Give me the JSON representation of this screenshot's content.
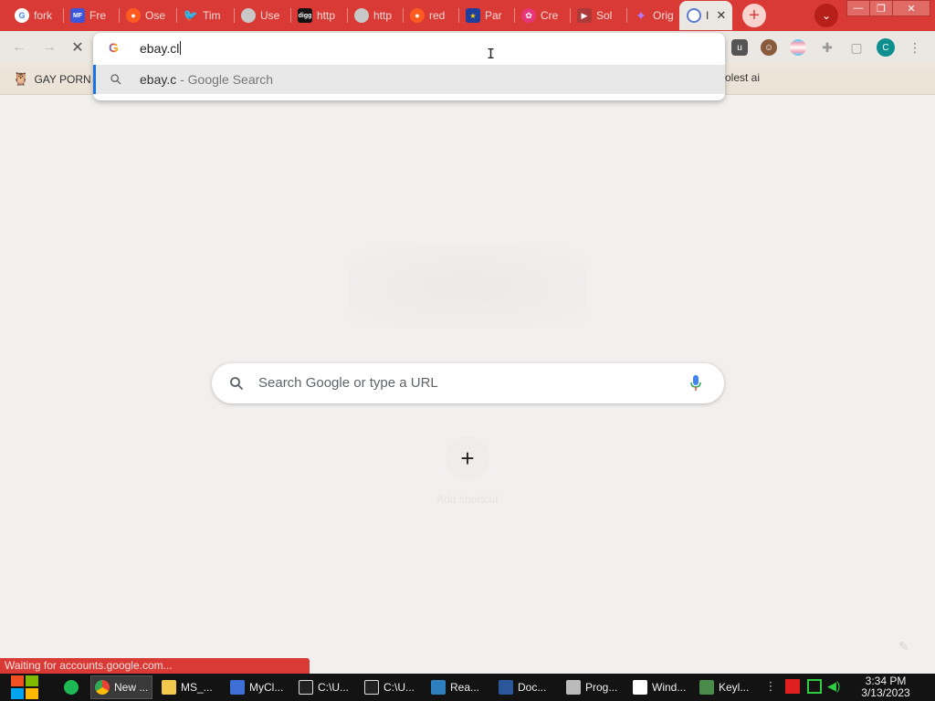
{
  "tabs": [
    {
      "label": "fork",
      "favicon": "google-icon",
      "color": "#ffffff"
    },
    {
      "label": "Fre",
      "favicon": "mft-icon",
      "color": "#3b56d8"
    },
    {
      "label": "Ose",
      "favicon": "reddit-icon",
      "color": "#ff5a1f"
    },
    {
      "label": "Tim",
      "favicon": "twitter-icon",
      "color": "#1da1f2"
    },
    {
      "label": "Use",
      "favicon": "globe-icon",
      "color": "#bbbbbb"
    },
    {
      "label": "http",
      "favicon": "digg-icon",
      "color": "#111111"
    },
    {
      "label": "http",
      "favicon": "globe-icon",
      "color": "#bbbbbb"
    },
    {
      "label": "red",
      "favicon": "reddit-icon",
      "color": "#ff5a1f"
    },
    {
      "label": "Par",
      "favicon": "eu-flag-icon",
      "color": "#1f3f9a"
    },
    {
      "label": "Cre",
      "favicon": "creative-icon",
      "color": "#e8367a"
    },
    {
      "label": "Sol",
      "favicon": "video-icon",
      "color": "#ad3a3a"
    },
    {
      "label": "Orig",
      "favicon": "star-icon",
      "color": "#8a4fd8"
    }
  ],
  "active_tab": {
    "label": "I",
    "favicon": "loading-icon",
    "close": "✕"
  },
  "window_controls": {
    "minimize": "—",
    "restore": "❐",
    "close": "✕"
  },
  "omnibox": {
    "typed_text": "ebay.cl",
    "suggestion_main": "ebay.c",
    "suggestion_sub": " - Google Search"
  },
  "bookmarks": [
    {
      "label": "GAY PORN",
      "icon": "owl-icon"
    },
    {
      "label": "olest ai",
      "icon": ""
    }
  ],
  "profile_initial": "C",
  "ntp": {
    "search_placeholder": "Search Google or type a URL",
    "shortcut_symbol": "+",
    "shortcut_label": "Add shortcut"
  },
  "status_text": "Waiting for accounts.google.com...",
  "taskbar": {
    "tasks": [
      {
        "label": "New ...",
        "icon": "chrome-icon",
        "active": true
      },
      {
        "label": "MS_...",
        "icon": "folder-icon",
        "active": false
      },
      {
        "label": "MyCl...",
        "icon": "vs-icon",
        "active": false
      },
      {
        "label": "C:\\U...",
        "icon": "7zip-icon",
        "active": false
      },
      {
        "label": "C:\\U...",
        "icon": "7zip-icon",
        "active": false
      },
      {
        "label": "Rea...",
        "icon": "reader-icon",
        "active": false
      },
      {
        "label": "Doc...",
        "icon": "word-icon",
        "active": false
      },
      {
        "label": "Prog...",
        "icon": "doc-icon",
        "active": false
      },
      {
        "label": "Wind...",
        "icon": "file-icon",
        "active": false
      },
      {
        "label": "Keyl...",
        "icon": "monitor-icon",
        "active": false
      }
    ],
    "time": "3:34 PM",
    "date": "3/13/2023"
  },
  "colors": {
    "brand_red": "#d93a36",
    "ntp_bg": "#f1f0ee",
    "accent_blue": "#1a73e8",
    "taskbar_bg": "#131313"
  }
}
